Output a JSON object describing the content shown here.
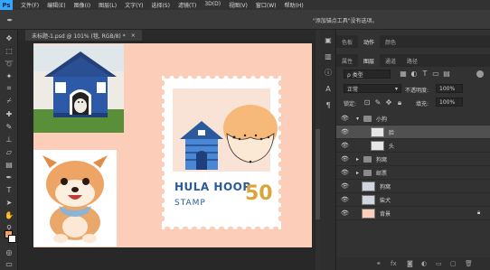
{
  "app": {
    "logo": "Ps"
  },
  "menu": [
    "文件(F)",
    "编辑(E)",
    "图像(I)",
    "图层(L)",
    "文字(Y)",
    "选择(S)",
    "滤镜(T)",
    "3D(D)",
    "视图(V)",
    "窗口(W)",
    "帮助(H)"
  ],
  "options": {
    "hint": "\"添加锚点工具\"没有选项。"
  },
  "document": {
    "tab_title": "未标题-1.psd @ 101% (毯, RGB/8) *",
    "close": "×"
  },
  "artwork": {
    "stamp_title": "HULA HOOP",
    "stamp_sub": "STAMP",
    "stamp_value": "50"
  },
  "panels": {
    "top_tabs": [
      "色板",
      "动作",
      "颜色"
    ],
    "top_active": 1,
    "layer_tabs": [
      "属性",
      "图层",
      "通道",
      "路径"
    ],
    "layer_active": 1,
    "filter_label": "ρ 类型",
    "blend_mode": "正常",
    "opacity_label": "不透明度:",
    "opacity_value": "100%",
    "lock_label": "锁定:",
    "fill_label": "填充:",
    "fill_value": "100%",
    "layers": [
      {
        "name": "小狗",
        "kind": "group",
        "open": true,
        "indent": 0
      },
      {
        "name": "脸",
        "kind": "shape",
        "indent": 1,
        "selected": true
      },
      {
        "name": "头",
        "kind": "shape",
        "indent": 1
      },
      {
        "name": "狗窝",
        "kind": "group",
        "indent": 0
      },
      {
        "name": "邮票",
        "kind": "group",
        "indent": 0
      },
      {
        "name": "狗窝",
        "kind": "image",
        "indent": 0
      },
      {
        "name": "柴犬",
        "kind": "image",
        "indent": 0
      },
      {
        "name": "背景",
        "kind": "bg",
        "indent": 0
      }
    ],
    "bottom_icons": [
      "link-icon",
      "fx-icon",
      "mask-icon",
      "adjust-icon",
      "folder-icon",
      "new-layer-icon",
      "trash-icon"
    ]
  },
  "colors": {
    "canvas": "#fccdb8",
    "stamp_blue": "#2a5a9c",
    "stamp_gold": "#d9a43a",
    "accent": "#31a8ff"
  }
}
